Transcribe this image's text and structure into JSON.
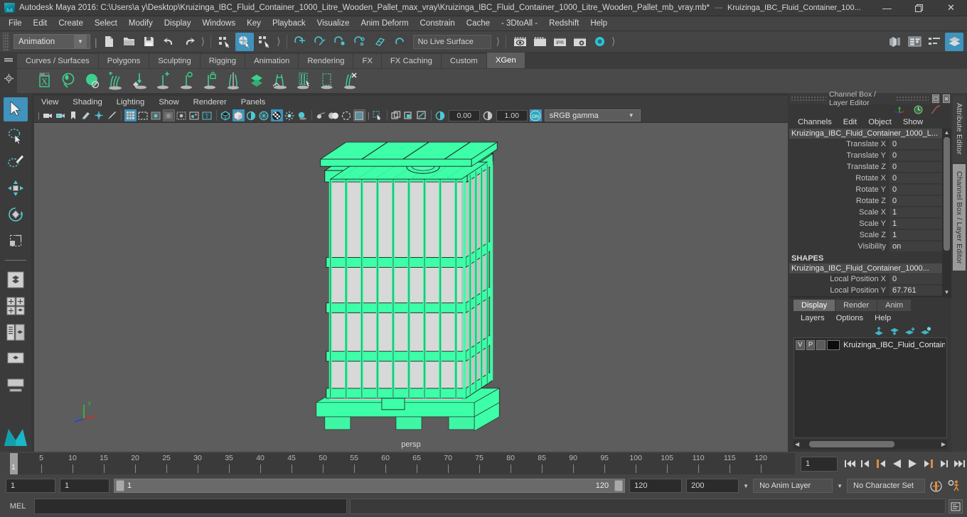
{
  "titlebar": {
    "app_title": "Autodesk Maya 2016: C:\\Users\\a y\\Desktop\\Kruizinga_IBC_Fluid_Container_1000_Litre_Wooden_Pallet_max_vray\\Kruizinga_IBC_Fluid_Container_1000_Litre_Wooden_Pallet_mb_vray.mb*",
    "separator": "---",
    "doc_title": "Kruizinga_IBC_Fluid_Container_100...",
    "minimize": "—",
    "maximize": "❐",
    "close": "✕"
  },
  "menubar": {
    "items": [
      "File",
      "Edit",
      "Create",
      "Select",
      "Modify",
      "Display",
      "Windows",
      "Key",
      "Playback",
      "Visualize",
      "Anim Deform",
      "Constrain",
      "Cache",
      "- 3DtoAll -",
      "Redshift",
      "Help"
    ]
  },
  "statusline": {
    "menu_set": "Animation",
    "live_surface": "No Live Surface",
    "icons": [
      "new-scene-icon",
      "open-scene-icon",
      "save-scene-icon",
      "undo-icon",
      "redo-icon",
      "select-by-hierarchy-icon",
      "select-by-object-icon",
      "select-by-component-icon",
      "snap-to-grid-icon",
      "snap-to-curve-icon",
      "snap-to-point-icon",
      "snap-to-projected-center-icon",
      "snap-to-view-plane-icon",
      "make-live-icon",
      "render-current-frame-icon",
      "render-sequence-icon",
      "ipr-render-icon",
      "render-settings-icon",
      "hypershade-icon"
    ],
    "right_icons": [
      "show-hide-modeling-toolkit-icon",
      "show-hide-attribute-editor-icon",
      "show-hide-tool-settings-icon",
      "show-hide-channel-box-icon"
    ]
  },
  "shelf": {
    "tabs": [
      "Curves / Surfaces",
      "Polygons",
      "Sculpting",
      "Rigging",
      "Animation",
      "Rendering",
      "FX",
      "FX Caching",
      "Custom",
      "XGen"
    ],
    "active_tab": "XGen",
    "icons": [
      "xgen-editor-icon",
      "create-description-icon",
      "preview-description-icon",
      "add-move-groom-icon",
      "sculpt-groom-icon",
      "place-guide-icon",
      "select-guide-icon",
      "freeze-guide-icon",
      "mirror-guide-icon",
      "clump-modifier-icon",
      "noise-modifier-icon",
      "cut-modifier-icon",
      "region-modifier-icon",
      "delete-guide-icon"
    ]
  },
  "toolbox": {
    "tools": [
      {
        "name": "select-tool",
        "active": true
      },
      {
        "name": "lasso-select-tool",
        "active": false
      },
      {
        "name": "paint-select-tool",
        "active": false
      },
      {
        "name": "move-tool",
        "active": false
      },
      {
        "name": "rotate-tool",
        "active": false
      },
      {
        "name": "scale-tool",
        "active": false
      }
    ],
    "layouts": [
      "single-perspective-layout-icon",
      "four-view-layout-icon",
      "outliner-persp-layout-icon",
      "persp-graph-layout-icon",
      "hypershade-layout-icon"
    ]
  },
  "viewport": {
    "menus": [
      "View",
      "Shading",
      "Lighting",
      "Show",
      "Renderer",
      "Panels"
    ],
    "camera_label": "persp",
    "exposure": "0.00",
    "gamma": "1.00",
    "color_management": "sRGB gamma",
    "color_management_toggle": "ON",
    "background_color": "#5d5d5d",
    "selection_color": "#3dffa8",
    "model_name": "IBC fluid container on wooden pallet (selected wireframe)"
  },
  "channel_box": {
    "panel_title": "Channel Box / Layer Editor",
    "menus": [
      "Channels",
      "Edit",
      "Object",
      "Show"
    ],
    "object_name": "Kruizinga_IBC_Fluid_Container_1000_L...",
    "attributes": [
      {
        "label": "Translate X",
        "value": "0"
      },
      {
        "label": "Translate Y",
        "value": "0"
      },
      {
        "label": "Translate Z",
        "value": "0"
      },
      {
        "label": "Rotate X",
        "value": "0"
      },
      {
        "label": "Rotate Y",
        "value": "0"
      },
      {
        "label": "Rotate Z",
        "value": "0"
      },
      {
        "label": "Scale X",
        "value": "1"
      },
      {
        "label": "Scale Y",
        "value": "1"
      },
      {
        "label": "Scale Z",
        "value": "1"
      },
      {
        "label": "Visibility",
        "value": "on"
      }
    ],
    "shapes_header": "SHAPES",
    "shape_name": "Kruizinga_IBC_Fluid_Container_1000...",
    "shape_attributes": [
      {
        "label": "Local Position X",
        "value": "0"
      },
      {
        "label": "Local Position Y",
        "value": "67.761"
      }
    ]
  },
  "side_tabs": [
    {
      "label": "Attribute Editor",
      "active": false
    },
    {
      "label": "Channel Box / Layer Editor",
      "active": true
    }
  ],
  "layer_editor": {
    "tabs": [
      "Display",
      "Render",
      "Anim"
    ],
    "active_tab": "Display",
    "menus": [
      "Layers",
      "Options",
      "Help"
    ],
    "buttons": [
      "move-layer-up-icon",
      "move-layer-down-icon",
      "create-new-layer-icon",
      "create-layer-from-selected-icon"
    ],
    "layers": [
      {
        "visibility": "V",
        "playback": "P",
        "state": "",
        "color": "#0c0c0c",
        "name": "Kruizinga_IBC_Fluid_Container_"
      }
    ]
  },
  "timeline": {
    "ticks": [
      5,
      10,
      15,
      20,
      25,
      30,
      35,
      40,
      45,
      50,
      55,
      60,
      65,
      70,
      75,
      80,
      85,
      90,
      95,
      100,
      105,
      110,
      115,
      120
    ],
    "current_frame_marker": "1",
    "current_frame_field": "1",
    "playback_buttons": [
      "go-to-start-icon",
      "step-back-keyframe-icon",
      "step-back-frame-icon",
      "play-backwards-icon",
      "play-forwards-icon",
      "step-forward-frame-icon",
      "step-forward-keyframe-icon",
      "go-to-end-icon"
    ]
  },
  "range_slider": {
    "anim_start": "1",
    "range_start": "1",
    "bar_start_label": "1",
    "bar_end_label": "120",
    "range_end": "120",
    "anim_end": "200",
    "anim_layer": "No Anim Layer",
    "character_set": "No Character Set",
    "auto_key_icon": "auto-keyframe-icon",
    "anim_prefs_icon": "animation-preferences-icon"
  },
  "command_line": {
    "language_label": "MEL",
    "input_value": "",
    "input_placeholder": "",
    "output_value": "",
    "script_editor_icon": "script-editor-icon"
  }
}
